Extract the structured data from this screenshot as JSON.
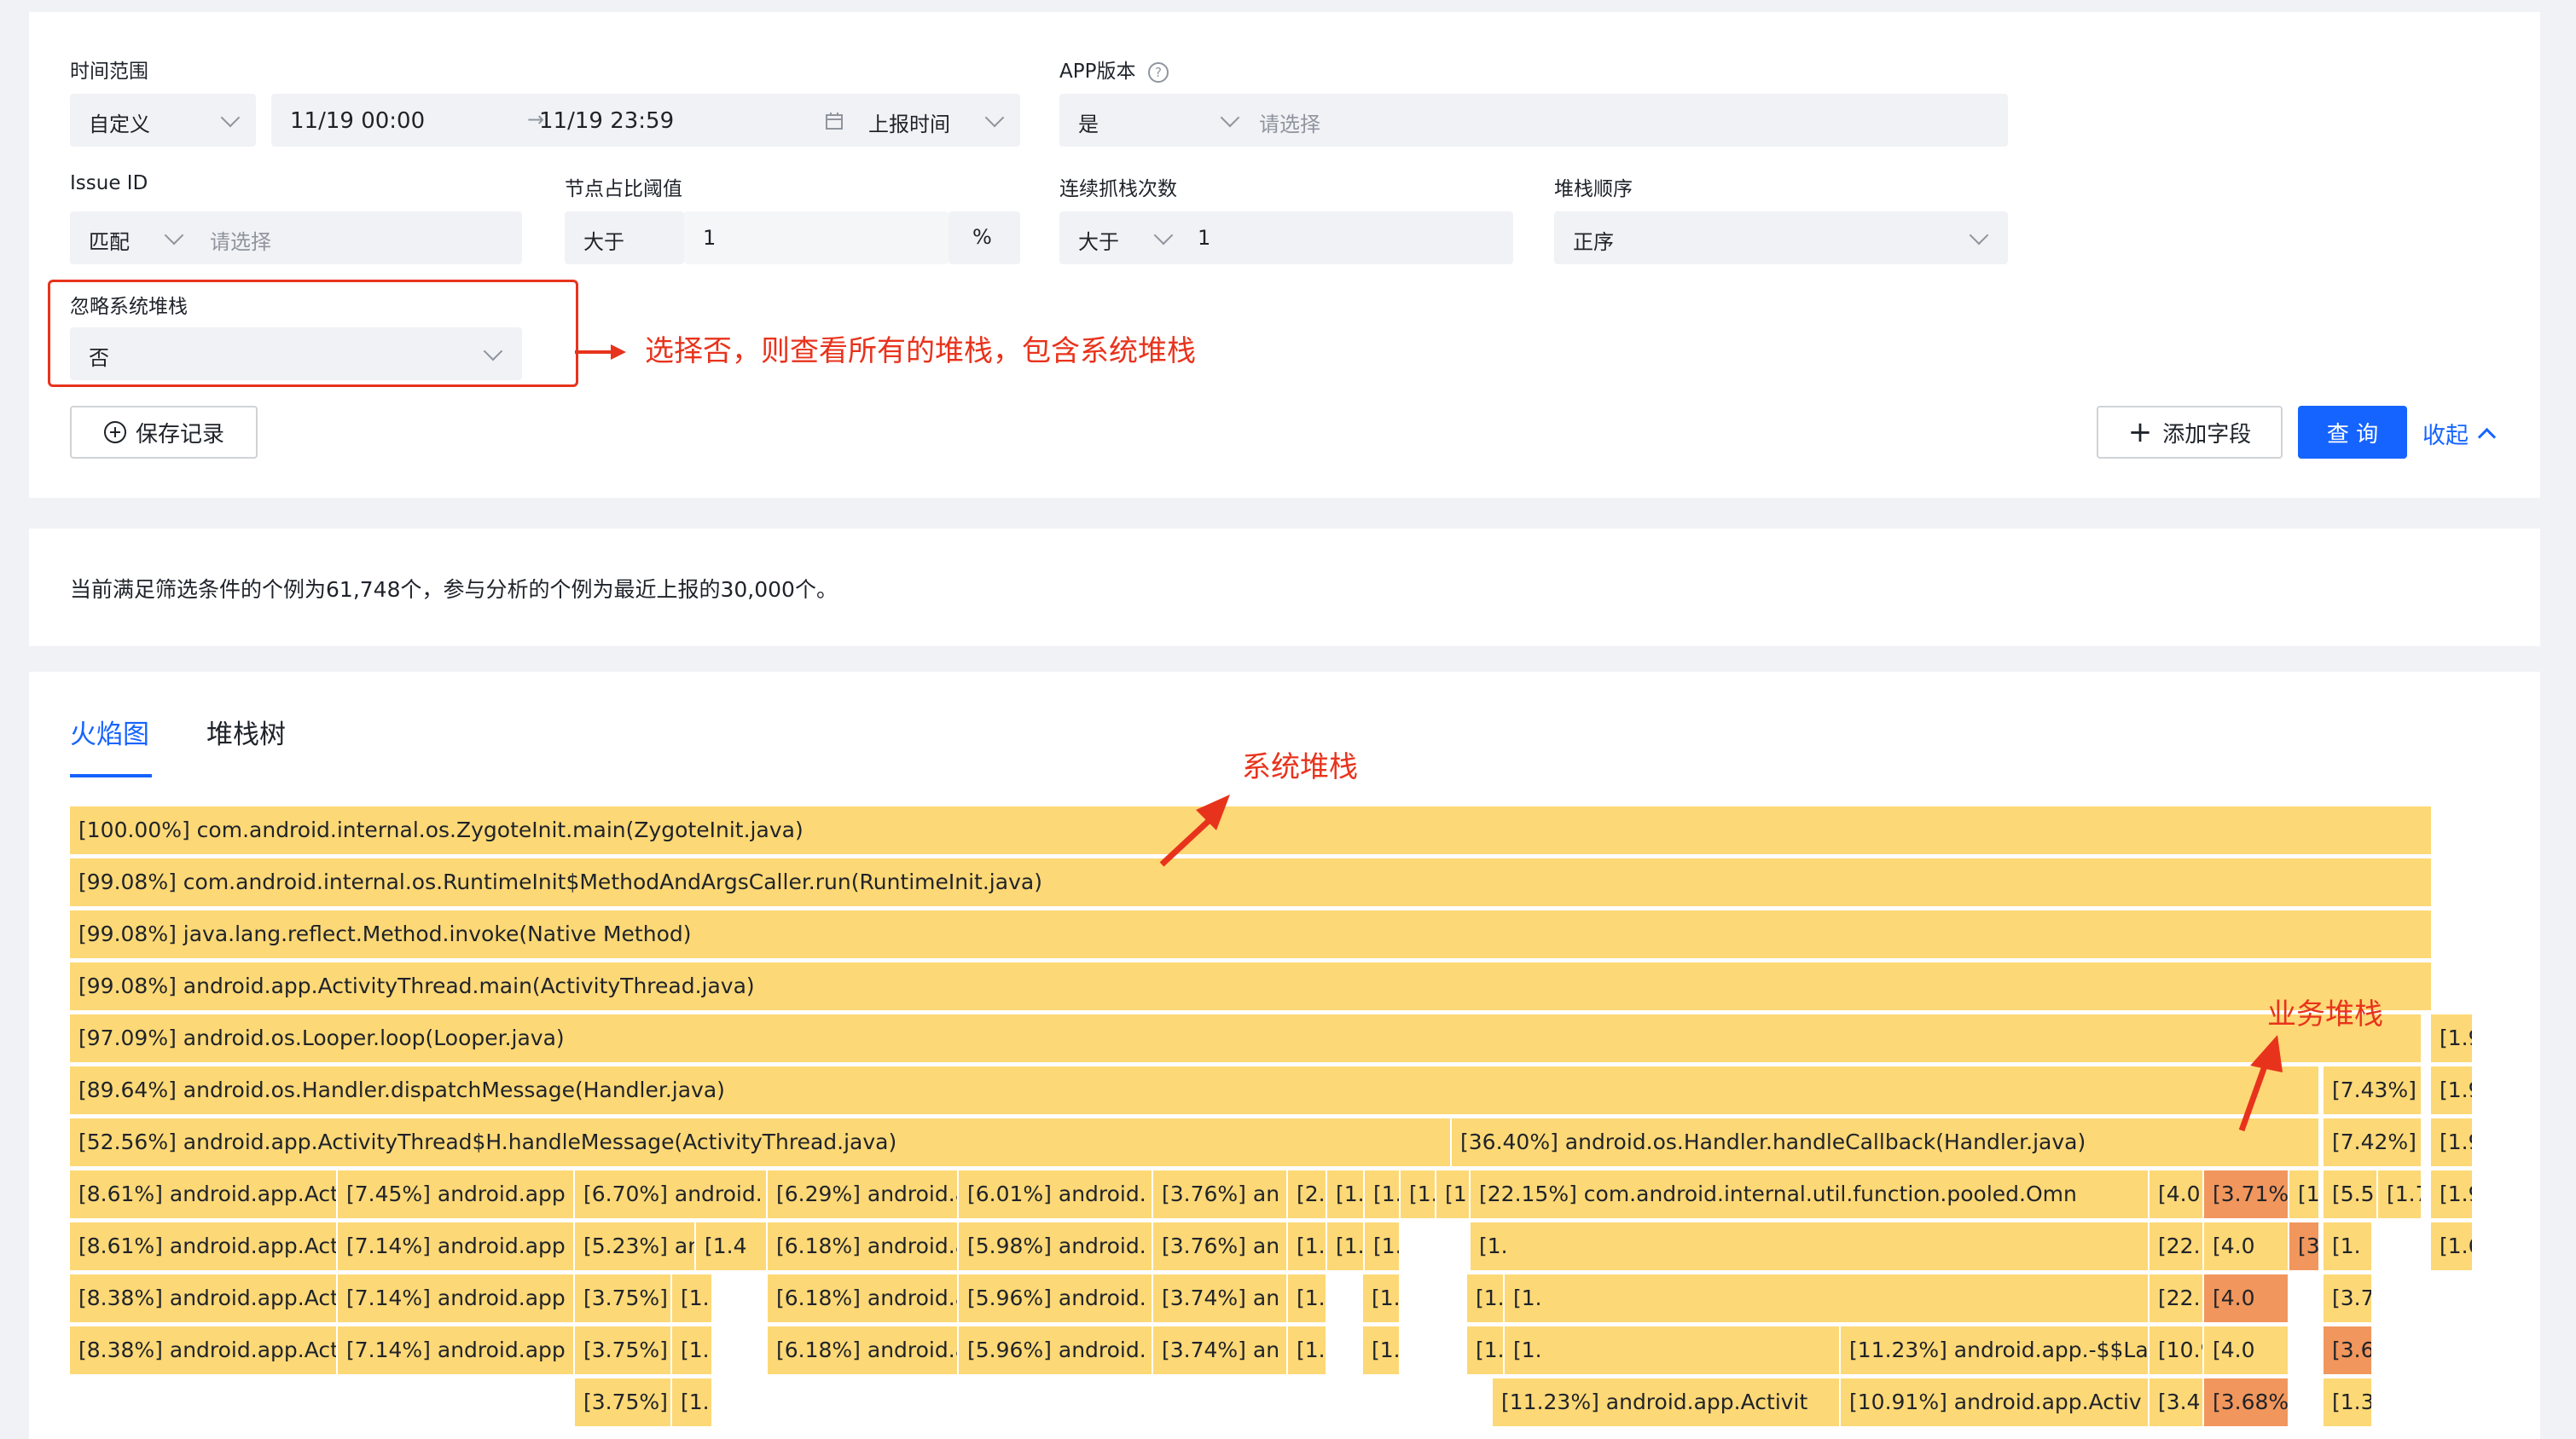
{
  "filters": {
    "time_range": {
      "label": "时间范围",
      "mode": "自定义",
      "start": "11/19 00:00",
      "end": "11/19 23:59",
      "time_type": "上报时间"
    },
    "app_version": {
      "label": "APP版本",
      "mode": "是",
      "placeholder": "请选择"
    },
    "issue_id": {
      "label": "Issue ID",
      "mode": "匹配",
      "placeholder": "请选择"
    },
    "node_threshold": {
      "label": "节点占比阈值",
      "op": "大于",
      "value": "1",
      "unit": "%"
    },
    "consecutive": {
      "label": "连续抓栈次数",
      "op": "大于",
      "value": "1"
    },
    "stack_order": {
      "label": "堆栈顺序",
      "value": "正序"
    },
    "ignore_system": {
      "label": "忽略系统堆栈",
      "value": "否"
    }
  },
  "annotations": {
    "ignore_note": "选择否，则查看所有的堆栈，包含系统堆栈",
    "system_stack": "系统堆栈",
    "business_stack": "业务堆栈"
  },
  "actions": {
    "save_record": "保存记录",
    "add_field": "添加字段",
    "query": "查 询",
    "collapse": "收起"
  },
  "summary": "当前满足筛选条件的个例为61,748个，参与分析的个例为最近上报的30,000个。",
  "tabs": [
    {
      "label": "火焰图",
      "active": true
    },
    {
      "label": "堆栈树",
      "active": false
    }
  ],
  "colors": {
    "accent": "#1664ff",
    "annotation": "#e8331c",
    "frame": "#fdd876",
    "frame_hot": "#f1965c"
  },
  "flame_rows": [
    {
      "frames": [
        "[100.00%] com.android.internal.os.ZygoteInit.main(ZygoteInit.java)"
      ]
    },
    {
      "frames": [
        "[99.08%] com.android.internal.os.RuntimeInit$MethodAndArgsCaller.run(RuntimeInit.java)"
      ]
    },
    {
      "frames": [
        "[99.08%] java.lang.reflect.Method.invoke(Native Method)"
      ]
    },
    {
      "frames": [
        "[99.08%] android.app.ActivityThread.main(ActivityThread.java)"
      ]
    },
    {
      "frames": [
        "[97.09%] android.os.Looper.loop(Looper.java)",
        "[1.9"
      ]
    },
    {
      "frames": [
        "[89.64%] android.os.Handler.dispatchMessage(Handler.java)",
        "[7.43%]",
        "[1.9"
      ]
    },
    {
      "frames": [
        "[52.56%] android.app.ActivityThread$H.handleMessage(ActivityThread.java)",
        "[36.40%] android.os.Handler.handleCallback(Handler.java)",
        "[7.42%]",
        "[1.9"
      ]
    },
    {
      "frames": [
        "[8.61%] android.app.Act",
        "[7.45%] android.app",
        "[6.70%] android.",
        "[6.29%] android.a",
        "[6.01%] android.",
        "[3.76%] an",
        "[2.",
        "[1.",
        "[1.",
        "[1.",
        "[1.",
        "[22.15%] com.android.internal.util.function.pooled.Omn",
        "[4.0",
        "[3.71%",
        "[1.",
        "[5.5",
        "[1.7",
        "[1.9"
      ]
    },
    {
      "frames": [
        "[8.61%] android.app.Act",
        "[7.14%] android.app",
        "[5.23%] and",
        "[1.4",
        "[6.18%] android.a",
        "[5.98%] android.",
        "[3.76%] an",
        "[1.",
        "[1.",
        "[1.",
        "[1.",
        "[22.15%] com.android.internal.util.function.pooled.Poo",
        "[4.0",
        "[3.71%",
        "[1.",
        "[1.6",
        "[1.5"
      ]
    },
    {
      "frames": [
        "[8.38%] android.app.Act",
        "[7.14%] android.app",
        "[3.75%]",
        "[1.",
        "[6.18%] android.a",
        "[5.96%] android.",
        "[3.74%] an",
        "[1.",
        "[1.",
        "[1.",
        "[1.",
        "[22.15%] com.android.internal.util.function.pooled.Poo",
        "[4.0",
        "[3.70%",
        "[1.6"
      ]
    },
    {
      "frames": [
        "[8.38%] android.app.Act",
        "[7.14%] android.app",
        "[3.75%]",
        "[1.",
        "[6.18%] android.a",
        "[5.96%] android.",
        "[3.74%] an",
        "[1.",
        "[1.",
        "[1.",
        "[1.",
        "[11.23%] android.app.-$$Lamb",
        "[10.91%] android.app.-$$La",
        "[4.0",
        "[3.68%",
        "[1.3"
      ]
    },
    {
      "frames": [
        "[3.75%]",
        "[1.",
        "[11.23%] android.app.Activit",
        "[10.91%] android.app.Activ",
        "[3.4",
        "[3.68%",
        "[1.3"
      ]
    }
  ]
}
